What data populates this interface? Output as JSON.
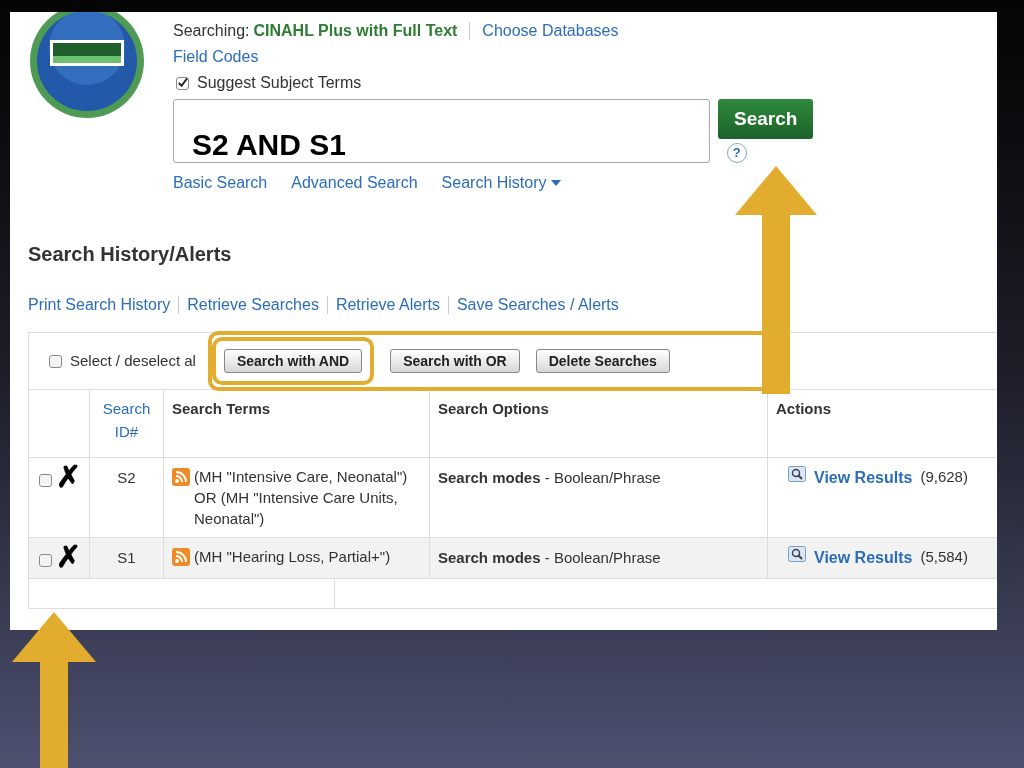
{
  "header": {
    "searching_label": "Searching:",
    "database": "CINAHL Plus with Full Text",
    "choose_link": "Choose Databases",
    "field_codes": "Field Codes",
    "suggest": {
      "label": "Suggest Subject Terms",
      "checked": true
    },
    "query_annotation": "S2 AND S1",
    "search_button": "Search",
    "help": "?",
    "nav": [
      {
        "label": "Basic Search",
        "dropdown": false
      },
      {
        "label": "Advanced Search",
        "dropdown": false
      },
      {
        "label": "Search History",
        "dropdown": true
      }
    ]
  },
  "history": {
    "title": "Search History/Alerts",
    "links": [
      "Print Search History",
      "Retrieve Searches",
      "Retrieve Alerts",
      "Save Searches / Alerts"
    ],
    "select_all": {
      "label": "Select / deselect al",
      "checked": false
    },
    "buttons": [
      "Search with AND",
      "Search with OR",
      "Delete Searches"
    ],
    "columns": [
      "Search ID#",
      "Search Terms",
      "Search Options",
      "Actions"
    ],
    "rows": [
      {
        "checked": false,
        "mark": "✗",
        "id": "S2",
        "terms": "(MH \"Intensive Care, Neonatal\") OR (MH \"Intensive Care Units, Neonatal\")",
        "options": "**Search modes** - Boolean/Phrase",
        "action": "View Results",
        "count": "(9,628)"
      },
      {
        "checked": false,
        "mark": "✗",
        "id": "S1",
        "terms": "(MH \"Hearing Loss, Partial+\")",
        "options": "**Search modes** - Boolean/Phrase",
        "action": "View Results",
        "count": "(5,584)"
      }
    ]
  }
}
